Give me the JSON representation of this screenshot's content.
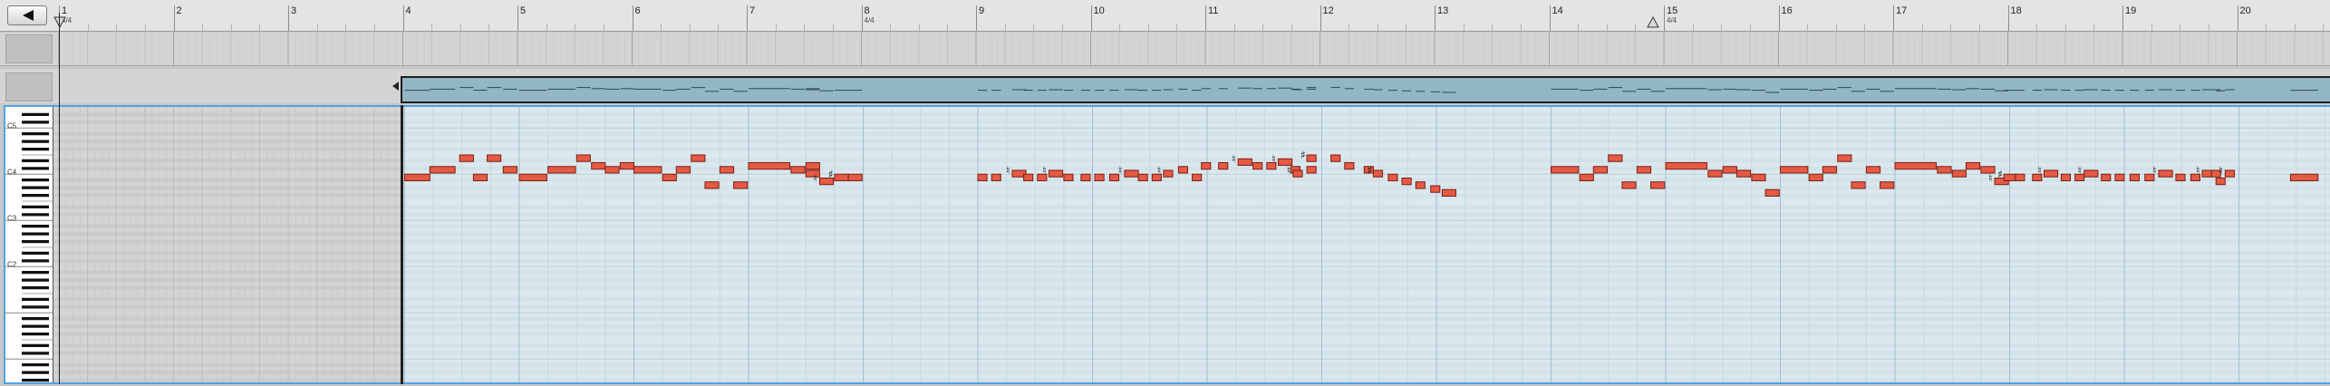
{
  "ruler": {
    "bars": [
      "1",
      "2",
      "3",
      "4",
      "5",
      "6",
      "7",
      "8",
      "9",
      "10",
      "11",
      "12",
      "13",
      "14",
      "15",
      "16",
      "17",
      "18",
      "19",
      "20"
    ],
    "time_signatures": [
      {
        "bar_index": 0,
        "text": "4/4"
      },
      {
        "bar_index": 7,
        "text": "4/4"
      },
      {
        "bar_index": 14,
        "text": "4/4"
      }
    ]
  },
  "keyboard": {
    "octave_labels": [
      "C5",
      "C4",
      "C3",
      "C2"
    ]
  },
  "toolbar": {
    "back_icon": "triangle-left-icon"
  },
  "colors": {
    "note_fill": "#e55a44",
    "note_border": "#7a1f14",
    "editor_bg": "#dbe8ee",
    "clip_strip": "#93b6c4",
    "selection_border": "#4ea2e6"
  },
  "notes": [
    {
      "bar": 4.0,
      "len": 0.22,
      "pitch": 59
    },
    {
      "bar": 4.22,
      "len": 0.22,
      "pitch": 61
    },
    {
      "bar": 4.48,
      "len": 0.12,
      "pitch": 64
    },
    {
      "bar": 4.6,
      "len": 0.12,
      "pitch": 59
    },
    {
      "bar": 4.72,
      "len": 0.12,
      "pitch": 64
    },
    {
      "bar": 4.86,
      "len": 0.12,
      "pitch": 61
    },
    {
      "bar": 5.0,
      "len": 0.24,
      "pitch": 59
    },
    {
      "bar": 5.25,
      "len": 0.24,
      "pitch": 61
    },
    {
      "bar": 5.5,
      "len": 0.12,
      "pitch": 64
    },
    {
      "bar": 5.63,
      "len": 0.12,
      "pitch": 62
    },
    {
      "bar": 5.75,
      "len": 0.12,
      "pitch": 61
    },
    {
      "bar": 5.88,
      "len": 0.12,
      "pitch": 62
    },
    {
      "bar": 6.0,
      "len": 0.24,
      "pitch": 61
    },
    {
      "bar": 6.25,
      "len": 0.12,
      "pitch": 59
    },
    {
      "bar": 6.37,
      "len": 0.12,
      "pitch": 61
    },
    {
      "bar": 6.5,
      "len": 0.12,
      "pitch": 64
    },
    {
      "bar": 6.62,
      "len": 0.12,
      "pitch": 57
    },
    {
      "bar": 6.75,
      "len": 0.12,
      "pitch": 61
    },
    {
      "bar": 6.87,
      "len": 0.12,
      "pitch": 57
    },
    {
      "bar": 7.0,
      "len": 0.36,
      "pitch": 62
    },
    {
      "bar": 7.37,
      "len": 0.12,
      "pitch": 61
    },
    {
      "bar": 7.5,
      "len": 0.12,
      "pitch": 62
    },
    {
      "bar": 7.5,
      "len": 0.12,
      "pitch": 60
    },
    {
      "bar": 7.62,
      "len": 0.12,
      "pitch": 58,
      "acc": "natural"
    },
    {
      "bar": 7.75,
      "len": 0.12,
      "pitch": 59,
      "acc": "sharp"
    },
    {
      "bar": 7.87,
      "len": 0.12,
      "pitch": 59
    },
    {
      "bar": 9.0,
      "len": 0.08,
      "pitch": 59
    },
    {
      "bar": 9.12,
      "len": 0.08,
      "pitch": 59
    },
    {
      "bar": 9.3,
      "len": 0.12,
      "pitch": 60,
      "acc": "natural"
    },
    {
      "bar": 9.4,
      "len": 0.08,
      "pitch": 59
    },
    {
      "bar": 9.52,
      "len": 0.08,
      "pitch": 59
    },
    {
      "bar": 9.62,
      "len": 0.12,
      "pitch": 60,
      "acc": "natural"
    },
    {
      "bar": 9.75,
      "len": 0.08,
      "pitch": 59
    },
    {
      "bar": 9.9,
      "len": 0.08,
      "pitch": 59
    },
    {
      "bar": 10.02,
      "len": 0.08,
      "pitch": 59
    },
    {
      "bar": 10.15,
      "len": 0.08,
      "pitch": 59
    },
    {
      "bar": 10.28,
      "len": 0.12,
      "pitch": 60,
      "acc": "natural"
    },
    {
      "bar": 10.4,
      "len": 0.08,
      "pitch": 59
    },
    {
      "bar": 10.52,
      "len": 0.08,
      "pitch": 59
    },
    {
      "bar": 10.62,
      "len": 0.08,
      "pitch": 60,
      "acc": "natural"
    },
    {
      "bar": 10.75,
      "len": 0.08,
      "pitch": 61
    },
    {
      "bar": 10.87,
      "len": 0.08,
      "pitch": 59
    },
    {
      "bar": 10.95,
      "len": 0.08,
      "pitch": 62
    },
    {
      "bar": 11.1,
      "len": 0.08,
      "pitch": 62
    },
    {
      "bar": 11.27,
      "len": 0.12,
      "pitch": 63,
      "acc": "natural"
    },
    {
      "bar": 11.4,
      "len": 0.08,
      "pitch": 62
    },
    {
      "bar": 11.52,
      "len": 0.08,
      "pitch": 62
    },
    {
      "bar": 11.62,
      "len": 0.12,
      "pitch": 63,
      "acc": "natural"
    },
    {
      "bar": 11.73,
      "len": 0.08,
      "pitch": 61
    },
    {
      "bar": 11.75,
      "len": 0.08,
      "pitch": 60,
      "acc": "natural"
    },
    {
      "bar": 11.87,
      "len": 0.08,
      "pitch": 61
    },
    {
      "bar": 11.87,
      "len": 0.08,
      "pitch": 64,
      "acc": "sharp"
    },
    {
      "bar": 12.08,
      "len": 0.08,
      "pitch": 64
    },
    {
      "bar": 12.2,
      "len": 0.08,
      "pitch": 62
    },
    {
      "bar": 12.37,
      "len": 0.08,
      "pitch": 61
    },
    {
      "bar": 12.45,
      "len": 0.08,
      "pitch": 60,
      "acc": "sharp"
    },
    {
      "bar": 12.58,
      "len": 0.08,
      "pitch": 59
    },
    {
      "bar": 12.7,
      "len": 0.08,
      "pitch": 58
    },
    {
      "bar": 12.82,
      "len": 0.08,
      "pitch": 57
    },
    {
      "bar": 12.95,
      "len": 0.08,
      "pitch": 56
    },
    {
      "bar": 13.05,
      "len": 0.12,
      "pitch": 55
    },
    {
      "bar": 14.0,
      "len": 0.24,
      "pitch": 61
    },
    {
      "bar": 14.25,
      "len": 0.12,
      "pitch": 59
    },
    {
      "bar": 14.37,
      "len": 0.12,
      "pitch": 61
    },
    {
      "bar": 14.5,
      "len": 0.12,
      "pitch": 64
    },
    {
      "bar": 14.62,
      "len": 0.12,
      "pitch": 57
    },
    {
      "bar": 14.75,
      "len": 0.12,
      "pitch": 61
    },
    {
      "bar": 14.87,
      "len": 0.12,
      "pitch": 57
    },
    {
      "bar": 15.0,
      "len": 0.36,
      "pitch": 62
    },
    {
      "bar": 15.37,
      "len": 0.12,
      "pitch": 60
    },
    {
      "bar": 15.5,
      "len": 0.12,
      "pitch": 61
    },
    {
      "bar": 15.62,
      "len": 0.12,
      "pitch": 60
    },
    {
      "bar": 15.75,
      "len": 0.12,
      "pitch": 59
    },
    {
      "bar": 15.87,
      "len": 0.12,
      "pitch": 55
    },
    {
      "bar": 16.0,
      "len": 0.24,
      "pitch": 61
    },
    {
      "bar": 16.25,
      "len": 0.12,
      "pitch": 59
    },
    {
      "bar": 16.37,
      "len": 0.12,
      "pitch": 61
    },
    {
      "bar": 16.5,
      "len": 0.12,
      "pitch": 64
    },
    {
      "bar": 16.62,
      "len": 0.12,
      "pitch": 57
    },
    {
      "bar": 16.75,
      "len": 0.12,
      "pitch": 61
    },
    {
      "bar": 16.87,
      "len": 0.12,
      "pitch": 57
    },
    {
      "bar": 17.0,
      "len": 0.36,
      "pitch": 62
    },
    {
      "bar": 17.37,
      "len": 0.12,
      "pitch": 61
    },
    {
      "bar": 17.5,
      "len": 0.12,
      "pitch": 60
    },
    {
      "bar": 17.62,
      "len": 0.12,
      "pitch": 62
    },
    {
      "bar": 17.75,
      "len": 0.12,
      "pitch": 61
    },
    {
      "bar": 17.87,
      "len": 0.12,
      "pitch": 58,
      "acc": "natural"
    },
    {
      "bar": 17.95,
      "len": 0.12,
      "pitch": 59,
      "acc": "sharp"
    },
    {
      "bar": 18.05,
      "len": 0.08,
      "pitch": 59
    },
    {
      "bar": 18.2,
      "len": 0.08,
      "pitch": 59
    },
    {
      "bar": 18.3,
      "len": 0.12,
      "pitch": 60,
      "acc": "natural"
    },
    {
      "bar": 18.45,
      "len": 0.08,
      "pitch": 59
    },
    {
      "bar": 18.57,
      "len": 0.08,
      "pitch": 59
    },
    {
      "bar": 18.65,
      "len": 0.12,
      "pitch": 60,
      "acc": "natural"
    },
    {
      "bar": 18.8,
      "len": 0.08,
      "pitch": 59
    },
    {
      "bar": 18.92,
      "len": 0.08,
      "pitch": 59
    },
    {
      "bar": 19.05,
      "len": 0.08,
      "pitch": 59
    },
    {
      "bar": 19.18,
      "len": 0.08,
      "pitch": 59
    },
    {
      "bar": 19.3,
      "len": 0.12,
      "pitch": 60,
      "acc": "natural"
    },
    {
      "bar": 19.45,
      "len": 0.08,
      "pitch": 59
    },
    {
      "bar": 19.58,
      "len": 0.08,
      "pitch": 59
    },
    {
      "bar": 19.68,
      "len": 0.08,
      "pitch": 60,
      "acc": "natural"
    },
    {
      "bar": 19.76,
      "len": 0.08,
      "pitch": 60
    },
    {
      "bar": 19.8,
      "len": 0.08,
      "pitch": 58
    },
    {
      "bar": 19.88,
      "len": 0.08,
      "pitch": 60,
      "acc": "natural"
    },
    {
      "bar": 20.45,
      "len": 0.24,
      "pitch": 59
    }
  ]
}
